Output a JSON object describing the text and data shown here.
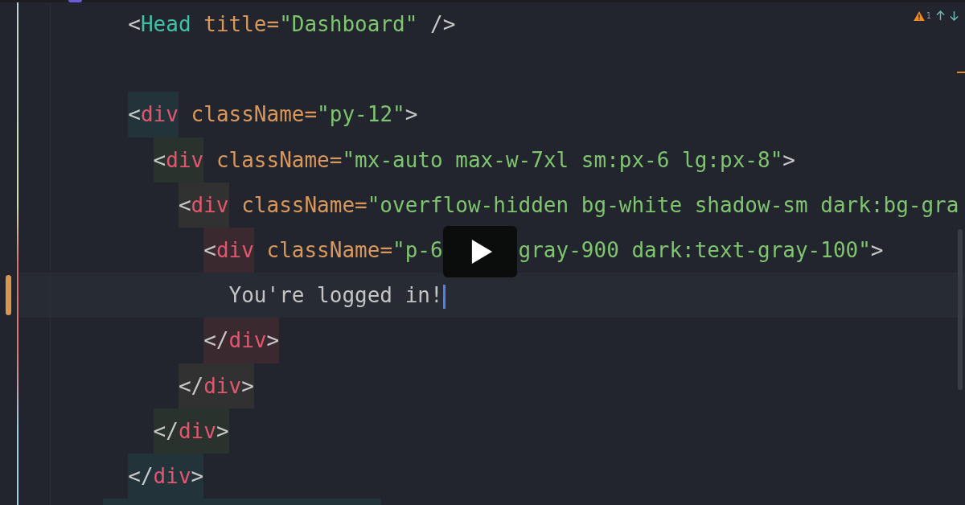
{
  "editor": {
    "problems": {
      "warnings": "1"
    },
    "lines": [
      {
        "kind": "code",
        "current": false,
        "tokens": [
          {
            "kind": "punct",
            "text": "<"
          },
          {
            "kind": "component",
            "text": "Head"
          },
          {
            "kind": "attr",
            "text": " title="
          },
          {
            "kind": "string",
            "text": "\"Dashboard\""
          },
          {
            "kind": "punct",
            "text": " />"
          }
        ]
      },
      {
        "kind": "blank",
        "current": false
      },
      {
        "kind": "code",
        "current": false,
        "tokens": [
          {
            "kind": "tag",
            "text": "<div",
            "color": "#23333a"
          },
          {
            "kind": "attr",
            "text": " className="
          },
          {
            "kind": "string",
            "text": "\"py-12\""
          },
          {
            "kind": "punct",
            "text": ">"
          }
        ],
        "children": [
          {
            "kind": "code",
            "current": false,
            "tokens": [
              {
                "kind": "tag",
                "text": "<div",
                "color": "#2a322e"
              },
              {
                "kind": "attr",
                "text": " className="
              },
              {
                "kind": "string",
                "text": "\"mx-auto max-w-7xl sm:px-6 lg:px-8\""
              },
              {
                "kind": "punct",
                "text": ">"
              }
            ],
            "children": [
              {
                "kind": "code",
                "current": false,
                "tokens": [
                  {
                    "kind": "tag",
                    "text": "<div",
                    "color": "#313131"
                  },
                  {
                    "kind": "attr",
                    "text": " className="
                  },
                  {
                    "kind": "string",
                    "text": "\"overflow-hidden bg-white shadow-sm dark:bg-gra"
                  }
                ],
                "children": [
                  {
                    "kind": "code",
                    "current": false,
                    "tokens": [
                      {
                        "kind": "tag",
                        "text": "<div",
                        "color": "#3a2a2f"
                      },
                      {
                        "kind": "attr",
                        "text": " className="
                      },
                      {
                        "kind": "string",
                        "text": "\"p-6"
                      },
                      {
                        "kind": "covered"
                      },
                      {
                        "kind": "string",
                        "text": "gray-900 dark:text-gray-100\""
                      },
                      {
                        "kind": "punct",
                        "text": ">"
                      }
                    ],
                    "children": [
                      {
                        "kind": "code",
                        "current": true,
                        "tokens": [
                          {
                            "kind": "plain",
                            "text": "You're logged in!"
                          }
                        ]
                      }
                    ],
                    "closing": [
                      {
                        "kind": "tag",
                        "text": "</div>",
                        "color": "#3a2a2f"
                      }
                    ]
                  }
                ],
                "closing": [
                  {
                    "kind": "tag",
                    "text": "</div>",
                    "color": "#313131"
                  }
                ]
              }
            ],
            "closing": [
              {
                "kind": "tag",
                "text": "</div>",
                "color": "#2a322e"
              }
            ]
          }
        ],
        "closing": [
          {
            "kind": "tag",
            "text": "</div>",
            "color": "#23333a"
          }
        ]
      }
    ]
  },
  "video": {
    "play_button": true
  }
}
